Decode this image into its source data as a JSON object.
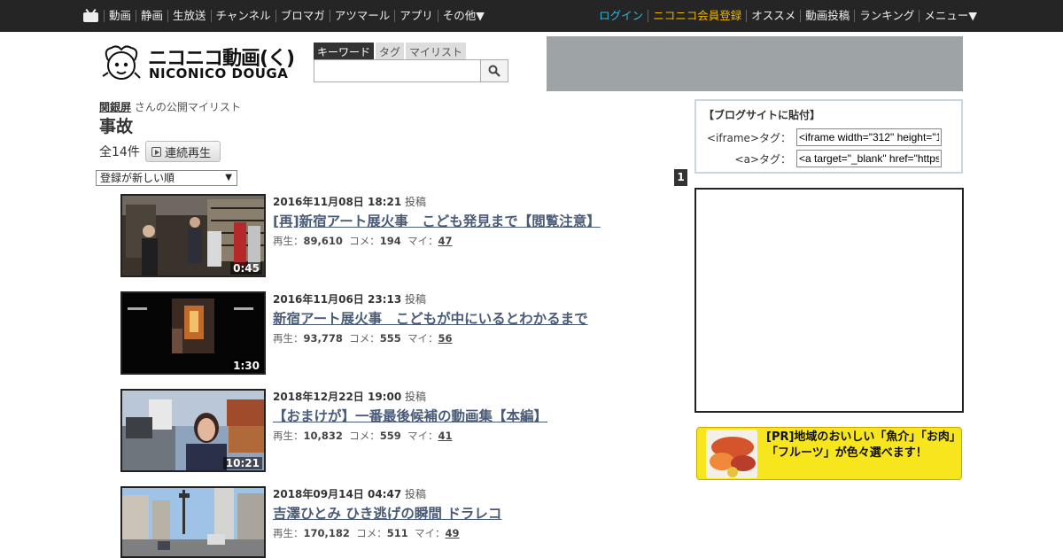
{
  "topnav": {
    "left_items": [
      "動画",
      "静画",
      "生放送",
      "チャンネル",
      "ブロマガ",
      "アツマール",
      "アプリ",
      "その他▼"
    ],
    "right_items": [
      "ログイン",
      "ニコニコ会員登録",
      "オススメ",
      "動画投稿",
      "ランキング",
      "メニュー▼"
    ]
  },
  "header": {
    "logo_text_ja": "ニコニコ動画(く)",
    "logo_text_en": "NICONICO DOUGA",
    "search_tabs": [
      "キーワード",
      "タグ",
      "マイリスト"
    ],
    "active_search_tab": "キーワード",
    "search_value": "",
    "search_icon": "magnifier-icon"
  },
  "mylist": {
    "owner": "関銀屏",
    "owner_suffix": "さんの公開マイリスト",
    "title": "事故",
    "count_label": "全14件",
    "play_all_label": "連続再生",
    "sort_label": "登録が新しい順",
    "page": "1"
  },
  "videos": [
    {
      "date": "2016年11月08日 18:21",
      "posted_suffix": "投稿",
      "title": "[再]新宿アート展火事　こども発見まで【閲覧注意】",
      "views": "89,610",
      "comments": "194",
      "mylists": "47",
      "duration": "0:45"
    },
    {
      "date": "2016年11月06日 23:13",
      "posted_suffix": "投稿",
      "title": "新宿アート展火事　こどもが中にいるとわかるまで",
      "views": "93,778",
      "comments": "555",
      "mylists": "56",
      "duration": "1:30"
    },
    {
      "date": "2018年12月22日 19:00",
      "posted_suffix": "投稿",
      "title": "【おまけが】一番最後候補の動画集【本編】",
      "views": "10,832",
      "comments": "559",
      "mylists": "41",
      "duration": "10:21"
    },
    {
      "date": "2018年09月14日 04:47",
      "posted_suffix": "投稿",
      "title": "吉澤ひとみ ひき逃げの瞬間 ドラレコ",
      "views": "170,182",
      "comments": "511",
      "mylists": "49",
      "duration": ""
    }
  ],
  "stats_labels": {
    "views": "再生：",
    "comments": "コメ：",
    "mylists": "マイ："
  },
  "blog_embed": {
    "title": "【ブログサイトに貼付】",
    "iframe_label": "<iframe>タグ：",
    "iframe_value": "<iframe width=\"312\" height=\"1",
    "a_label": "<a>タグ：",
    "a_value": "<a target=\"_blank\" href=\"https"
  },
  "pr": {
    "text": "[PR]地域のおいしい「魚介」「お肉」「フルーツ」が色々選べます！"
  },
  "colors": {
    "topbar_bg": "#252525",
    "login": "#38b3d6",
    "premium": "#f0b400",
    "video_title": "#4a5b78",
    "pr_bg": "#f7e61e",
    "ad_bg": "#9ea3a6"
  }
}
